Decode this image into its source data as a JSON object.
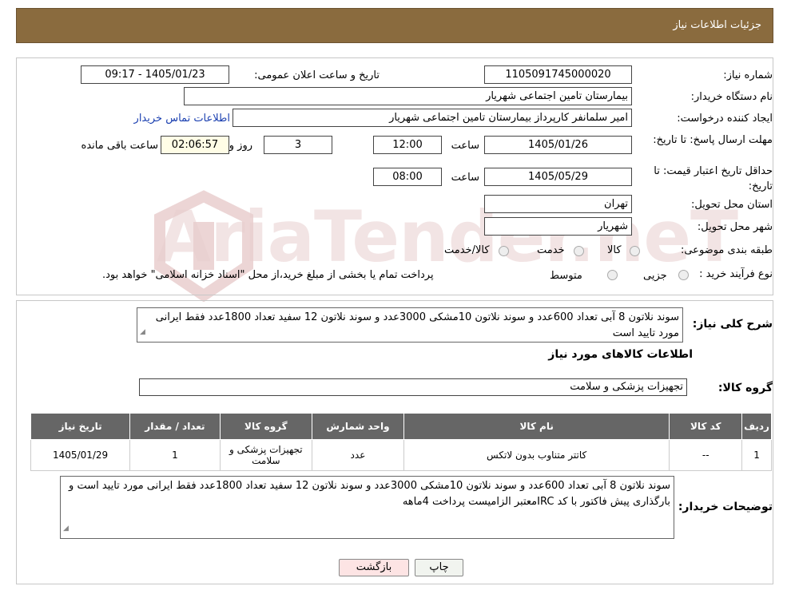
{
  "header": {
    "title": "جزئیات اطلاعات نیاز"
  },
  "watermark": {
    "text": "AriaTender.neT"
  },
  "form": {
    "need_number_label": "شماره نیاز:",
    "need_number": "1105091745000020",
    "announce_label": "تاریخ و ساعت اعلان عمومی:",
    "announce_value": "1405/01/23 - 09:17",
    "buyer_org_label": "نام دستگاه خریدار:",
    "buyer_org": "بیمارستان تامین اجتماعی شهریار",
    "creator_label": "ایجاد کننده درخواست:",
    "creator": "امیر سلمانفر کارپرداز بیمارستان تامین اجتماعی شهریار",
    "contact_link": "اطلاعات تماس خریدار",
    "deadline_label": "مهلت ارسال پاسخ: تا تاریخ:",
    "deadline_date": "1405/01/26",
    "time_label": "ساعت",
    "deadline_time": "12:00",
    "days": "3",
    "days_label": "روز و",
    "remaining_time": "02:06:57",
    "remaining_label": "ساعت باقی مانده",
    "validity_label": "حداقل تاریخ اعتبار قیمت: تا تاریخ:",
    "validity_date": "1405/05/29",
    "validity_time": "08:00",
    "province_label": "استان محل تحویل:",
    "province": "تهران",
    "city_label": "شهر محل تحویل:",
    "city": "شهریار",
    "category_label": "طبقه بندی موضوعی:",
    "category_options": [
      "کالا",
      "خدمت",
      "کالا/خدمت"
    ],
    "process_label": "نوع فرآیند خرید :",
    "process_options": [
      "جزیی",
      "متوسط"
    ],
    "process_note": "پرداخت تمام یا بخشی از مبلغ خرید،از محل \"اسناد خزانه اسلامی\" خواهد بود."
  },
  "description": {
    "label": "شرح کلی نیاز:",
    "text": "سوند نلاتون 8 آبی تعداد 600عدد و سوند نلاتون 10مشکی 3000عدد و سوند نلاتون 12 سفید تعداد 1800عدد فقط ایرانی مورد تایید است"
  },
  "goods": {
    "section_title": "اطلاعات کالاهای مورد نیاز",
    "group_label": "گروه کالا:",
    "group_value": "تجهیزات پزشکی و سلامت",
    "columns": [
      "ردیف",
      "کد کالا",
      "نام کالا",
      "واحد شمارش",
      "گروه کالا",
      "تعداد / مقدار",
      "تاریخ نیاز"
    ],
    "rows": [
      {
        "row": "1",
        "code": "--",
        "name": "کاتتر متناوب بدون لاتکس",
        "unit": "عدد",
        "group": "تجهیزات پزشکی و سلامت",
        "qty": "1",
        "date": "1405/01/29"
      }
    ]
  },
  "buyer_notes": {
    "label": "توضیحات خریدار:",
    "text": "سوند نلاتون 8 آبی تعداد 600عدد و سوند نلاتون 10مشکی 3000عدد و سوند نلاتون 12 سفید تعداد 1800عدد فقط ایرانی مورد تایید است و بارگذاری پیش فاکتور با کد IRCمعتبر الزامیست پرداخت 4ماهه"
  },
  "buttons": {
    "print": "چاپ",
    "back": "بازگشت"
  }
}
